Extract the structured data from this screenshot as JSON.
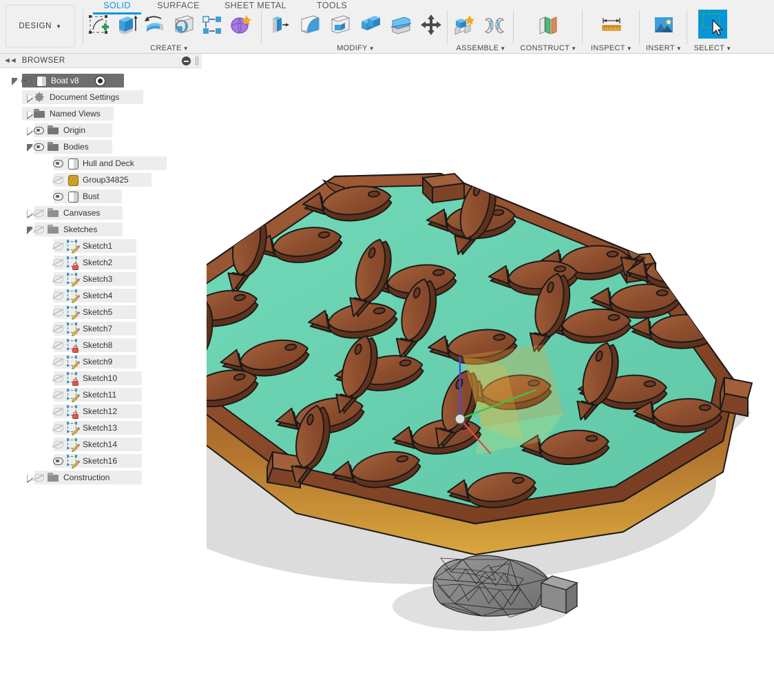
{
  "app": {
    "workspace_label": "DESIGN",
    "accent_color": "#0696d7",
    "panel_bg": "#f0f0f0"
  },
  "toolbar": {
    "tabs": [
      {
        "label": "SOLID",
        "active": true
      },
      {
        "label": "SURFACE",
        "active": false
      },
      {
        "label": "SHEET METAL",
        "active": false
      },
      {
        "label": "TOOLS",
        "active": false
      }
    ],
    "panels": [
      {
        "label": "CREATE",
        "has_caret": true,
        "buttons": [
          {
            "icon": "create-sketch-icon",
            "name": "create-sketch-button"
          },
          {
            "icon": "extrude-icon",
            "name": "extrude-button"
          },
          {
            "icon": "revolve-icon",
            "name": "revolve-button"
          },
          {
            "icon": "sphere-icon",
            "name": "sphere-button"
          },
          {
            "icon": "pattern-icon",
            "name": "pattern-button"
          },
          {
            "icon": "create-form-icon",
            "name": "create-form-button"
          }
        ]
      },
      {
        "label": "MODIFY",
        "has_caret": true,
        "buttons": [
          {
            "icon": "press-pull-icon",
            "name": "press-pull-button"
          },
          {
            "icon": "fillet-icon",
            "name": "fillet-button"
          },
          {
            "icon": "shell-icon",
            "name": "shell-button"
          },
          {
            "icon": "combine-icon",
            "name": "combine-button"
          },
          {
            "icon": "split-face-icon",
            "name": "split-face-button"
          },
          {
            "icon": "move-copy-icon",
            "name": "move-copy-button"
          }
        ]
      },
      {
        "label": "ASSEMBLE",
        "has_caret": true,
        "buttons": [
          {
            "icon": "new-component-icon",
            "name": "new-component-button"
          },
          {
            "icon": "joint-icon",
            "name": "joint-button"
          }
        ]
      },
      {
        "label": "CONSTRUCT",
        "has_caret": true,
        "buttons": [
          {
            "icon": "offset-plane-icon",
            "name": "offset-plane-button"
          }
        ]
      },
      {
        "label": "INSPECT",
        "has_caret": true,
        "buttons": [
          {
            "icon": "measure-icon",
            "name": "measure-button"
          }
        ]
      },
      {
        "label": "INSERT",
        "has_caret": true,
        "buttons": [
          {
            "icon": "insert-image-icon",
            "name": "insert-image-button"
          }
        ]
      },
      {
        "label": "SELECT",
        "has_caret": true,
        "selected": true,
        "buttons": [
          {
            "icon": "select-window-icon",
            "name": "select-tool-button"
          }
        ]
      }
    ]
  },
  "browser": {
    "title": "BROWSER",
    "collapse_icon": "collapse-left-icon",
    "minus_icon": "minus-circle-icon",
    "grip_icon": "drag-grip-icon",
    "tree": [
      {
        "label": "Boat v8",
        "depth": 0,
        "arrow": "open",
        "eye": "on",
        "icon": "body-icon",
        "selected": true,
        "radio": true
      },
      {
        "label": "Document Settings",
        "depth": 1,
        "arrow": "closed",
        "eye": "none",
        "icon": "gear-icon"
      },
      {
        "label": "Named Views",
        "depth": 1,
        "arrow": "closed",
        "eye": "none",
        "icon": "folder-icon"
      },
      {
        "label": "Origin",
        "depth": 1,
        "arrow": "closed",
        "eye": "on",
        "icon": "folder-icon"
      },
      {
        "label": "Bodies",
        "depth": 1,
        "arrow": "open",
        "eye": "on",
        "icon": "folder-icon"
      },
      {
        "label": "Hull and Deck",
        "depth": 2,
        "arrow": "none",
        "eye": "on",
        "icon": "body-icon"
      },
      {
        "label": "Group34825",
        "depth": 2,
        "arrow": "none",
        "eye": "off",
        "icon": "mesh-body-icon"
      },
      {
        "label": "Bust",
        "depth": 2,
        "arrow": "none",
        "eye": "on",
        "icon": "body-icon"
      },
      {
        "label": "Canvases",
        "depth": 1,
        "arrow": "closed",
        "eye": "off",
        "icon": "folder-icon"
      },
      {
        "label": "Sketches",
        "depth": 1,
        "arrow": "open",
        "eye": "off",
        "icon": "folder-icon"
      },
      {
        "label": "Sketch1",
        "depth": 2,
        "arrow": "none",
        "eye": "off",
        "icon": "sketch-icon"
      },
      {
        "label": "Sketch2",
        "depth": 2,
        "arrow": "none",
        "eye": "off",
        "icon": "sketch-locked-icon"
      },
      {
        "label": "Sketch3",
        "depth": 2,
        "arrow": "none",
        "eye": "off",
        "icon": "sketch-icon"
      },
      {
        "label": "Sketch4",
        "depth": 2,
        "arrow": "none",
        "eye": "off",
        "icon": "sketch-icon"
      },
      {
        "label": "Sketch5",
        "depth": 2,
        "arrow": "none",
        "eye": "off",
        "icon": "sketch-icon"
      },
      {
        "label": "Sketch7",
        "depth": 2,
        "arrow": "none",
        "eye": "off",
        "icon": "sketch-icon"
      },
      {
        "label": "Sketch8",
        "depth": 2,
        "arrow": "none",
        "eye": "off",
        "icon": "sketch-locked-icon"
      },
      {
        "label": "Sketch9",
        "depth": 2,
        "arrow": "none",
        "eye": "off",
        "icon": "sketch-icon"
      },
      {
        "label": "Sketch10",
        "depth": 2,
        "arrow": "none",
        "eye": "off",
        "icon": "sketch-locked-icon"
      },
      {
        "label": "Sketch11",
        "depth": 2,
        "arrow": "none",
        "eye": "off",
        "icon": "sketch-icon"
      },
      {
        "label": "Sketch12",
        "depth": 2,
        "arrow": "none",
        "eye": "off",
        "icon": "sketch-locked-icon"
      },
      {
        "label": "Sketch13",
        "depth": 2,
        "arrow": "none",
        "eye": "off",
        "icon": "sketch-icon"
      },
      {
        "label": "Sketch14",
        "depth": 2,
        "arrow": "none",
        "eye": "off",
        "icon": "sketch-icon"
      },
      {
        "label": "Sketch16",
        "depth": 2,
        "arrow": "none",
        "eye": "on",
        "icon": "sketch-icon"
      },
      {
        "label": "Construction",
        "depth": 1,
        "arrow": "closed",
        "eye": "off",
        "icon": "folder-icon"
      }
    ]
  },
  "viewport": {
    "background": "#ffffff",
    "model_name": "Boat v8",
    "colors": {
      "deck": "#6ed3b4",
      "hull_wood": "#9a5533",
      "hull_wood_dark": "#7b3f23",
      "fish_wood": "#8a4a2c",
      "fish_wood_light": "#a9603a",
      "outline": "#1a1a1a",
      "shadow": "#d9d9d9",
      "mesh": "#8c8c8c",
      "axis_x": "#e04a4a",
      "axis_y": "#44c44a",
      "axis_z": "#4a4ae0",
      "plane_xy": "#e6a93a"
    },
    "objects": [
      {
        "name": "hull-and-deck",
        "kind": "solid-body"
      },
      {
        "name": "fish-array",
        "kind": "solid-body",
        "count": 38
      },
      {
        "name": "bust-mesh",
        "kind": "mesh-body"
      },
      {
        "name": "origin-planes",
        "kind": "construction"
      }
    ]
  }
}
